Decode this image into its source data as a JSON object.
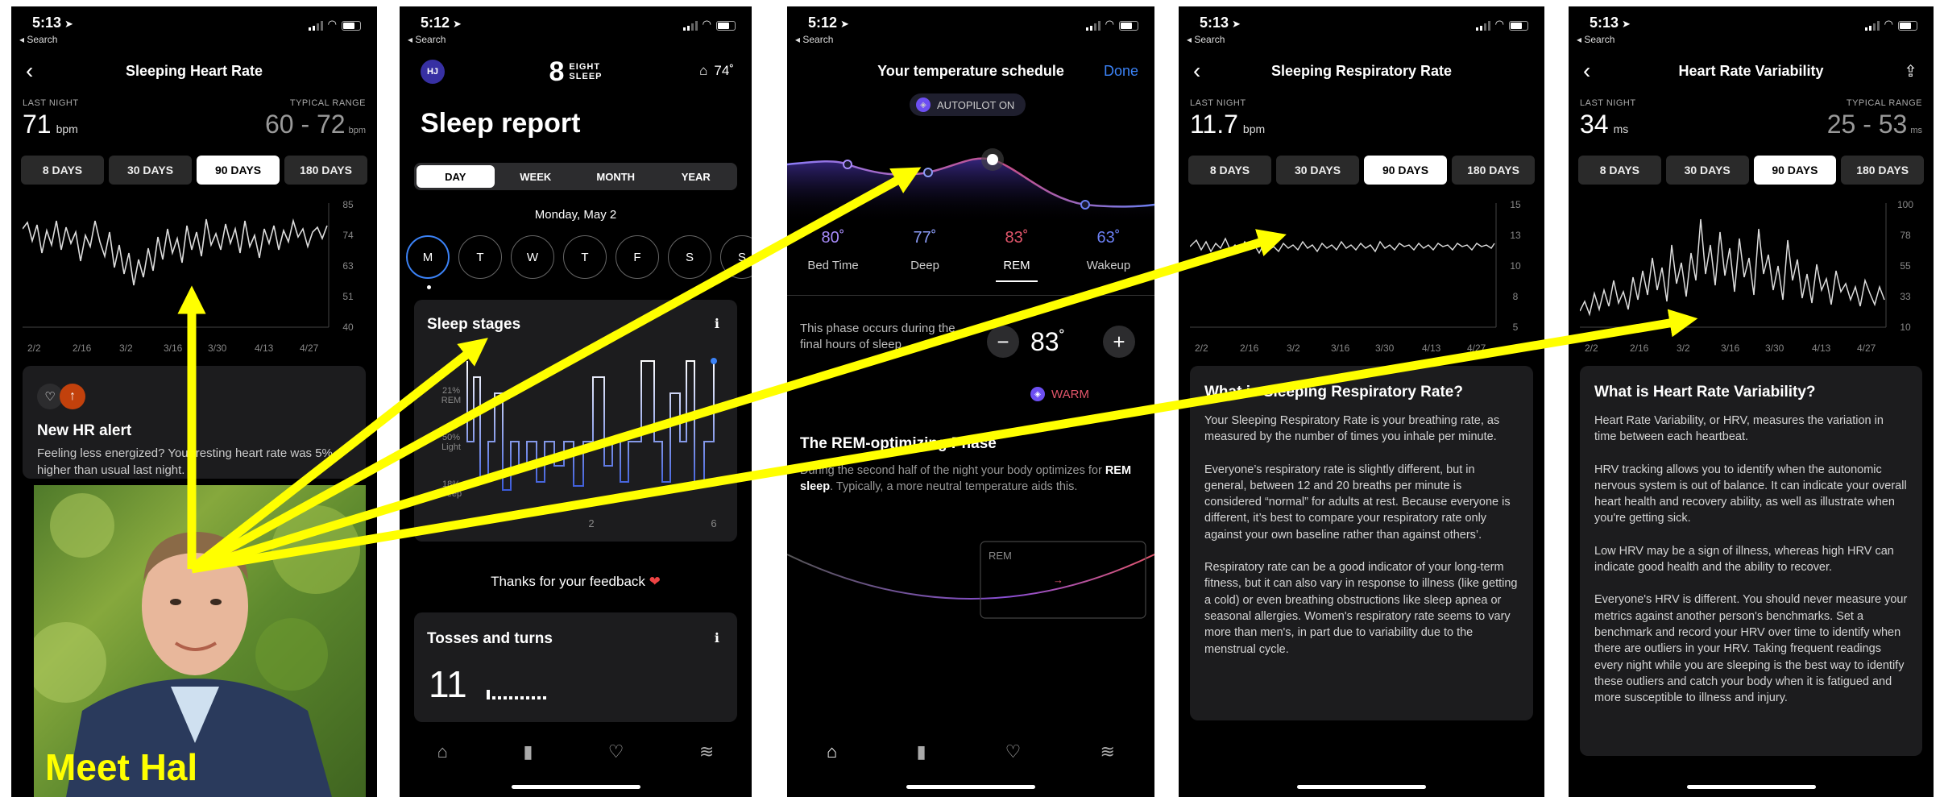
{
  "screens": {
    "hr": {
      "time": "5:13",
      "back_label": "◂ Search",
      "title": "Sleeping Heart Rate",
      "last_night_label": "LAST NIGHT",
      "value": "71",
      "unit": "bpm",
      "typical_label": "TYPICAL RANGE",
      "range": "60 - 72",
      "range_unit": "bpm",
      "tabs": [
        "8 DAYS",
        "30 DAYS",
        "90 DAYS",
        "180 DAYS"
      ],
      "active_tab": 2,
      "y_ticks": [
        "85",
        "74",
        "63",
        "51",
        "40"
      ],
      "x_ticks": [
        "2/2",
        "2/16",
        "3/2",
        "3/16",
        "3/30",
        "4/13",
        "4/27"
      ],
      "alert_title": "New HR alert",
      "alert_text": "Feeling less energized? Your resting heart rate was 5% higher than usual last night.",
      "photo_caption": "Meet Hal"
    },
    "report": {
      "time": "5:12",
      "back_label": "◂ Search",
      "avatar": "HJ",
      "logo_mark": "8",
      "logo_text_1": "EIGHT",
      "logo_text_2": "SLEEP",
      "temp": "74˚",
      "title": "Sleep report",
      "tabs": [
        "DAY",
        "WEEK",
        "MONTH",
        "YEAR"
      ],
      "active_tab": 0,
      "date": "Monday, May 2",
      "days": [
        "M",
        "T",
        "W",
        "T",
        "F",
        "S",
        "S"
      ],
      "stages_title": "Sleep stages",
      "stage_labels": [
        {
          "pct": "21%",
          "name": "REM"
        },
        {
          "pct": "50%",
          "name": "Light"
        },
        {
          "pct": "18%",
          "name": "Deep"
        }
      ],
      "stage_x_ticks": [
        "8",
        "2",
        "6"
      ],
      "feedback": "Thanks for your feedback",
      "tosses_title": "Tosses and turns",
      "tosses_value": "11"
    },
    "temp": {
      "time": "5:12",
      "back_label": "◂ Search",
      "title": "Your temperature schedule",
      "done": "Done",
      "autopilot": "AUTOPILOT ON",
      "phases": [
        {
          "temp": "80˚",
          "name": "Bed Time",
          "color": "#a78bfa"
        },
        {
          "temp": "77˚",
          "name": "Deep",
          "color": "#8b9cf7"
        },
        {
          "temp": "83˚",
          "name": "REM",
          "color": "#e0556a"
        },
        {
          "temp": "63˚",
          "name": "Wakeup",
          "color": "#6b7ff2"
        }
      ],
      "active_phase": 2,
      "phase_desc": "This phase occurs during the final hours of sleep.",
      "current_temp": "83",
      "deg": "˚",
      "warm": "WARM",
      "rem_title": "The REM-optimizing Phase",
      "rem_p_pre": "During the second half of the night your body optimizes for ",
      "rem_p_bold": "REM sleep",
      "rem_p_post": ". Typically, a more neutral temperature aids this.",
      "rem_box_label": "REM"
    },
    "resp": {
      "time": "5:13",
      "back_label": "◂ Search",
      "title": "Sleeping Respiratory Rate",
      "last_night_label": "LAST NIGHT",
      "value": "11.7",
      "unit": "bpm",
      "tabs": [
        "8 DAYS",
        "30 DAYS",
        "90 DAYS",
        "180 DAYS"
      ],
      "active_tab": 2,
      "y_ticks": [
        "15",
        "13",
        "10",
        "8",
        "5"
      ],
      "x_ticks": [
        "2/2",
        "2/16",
        "3/2",
        "3/16",
        "3/30",
        "4/13",
        "4/27"
      ],
      "info_title": "What is Sleeping Respiratory Rate?",
      "paras": [
        "Your Sleeping Respiratory Rate is your breathing rate, as measured by the number of times you inhale per minute.",
        "Everyone’s respiratory rate is slightly different, but in general, between 12 and 20 breaths per minute is considered “normal” for adults at rest. Because everyone is different, it’s best to compare your respiratory rate only against your own baseline rather than against others’.",
        "Respiratory rate can be a good indicator of your long-term fitness, but it can also vary in response to illness (like getting a cold) or even breathing obstructions like sleep apnea or seasonal allergies. Women's respiratory rate seems to vary more than men's, in part due to variability due to the menstrual cycle."
      ]
    },
    "hrv": {
      "time": "5:13",
      "back_label": "◂ Search",
      "title": "Heart Rate Variability",
      "last_night_label": "LAST NIGHT",
      "value": "34",
      "unit": "ms",
      "typical_label": "TYPICAL RANGE",
      "range": "25 - 53",
      "range_unit": "ms",
      "tabs": [
        "8 DAYS",
        "30 DAYS",
        "90 DAYS",
        "180 DAYS"
      ],
      "active_tab": 2,
      "y_ticks": [
        "100",
        "78",
        "55",
        "33",
        "10"
      ],
      "x_ticks": [
        "2/2",
        "2/16",
        "3/2",
        "3/16",
        "3/30",
        "4/13",
        "4/27"
      ],
      "info_title": "What is Heart Rate Variability?",
      "paras": [
        "Heart Rate Variability, or HRV, measures the variation in time between each heartbeat.",
        "HRV tracking allows you to identify when the autonomic nervous system is out of balance. It can indicate your overall heart health and recovery ability, as well as illustrate when you're getting sick.",
        "Low HRV may be a sign of illness, whereas high HRV can indicate good health and the ability to recover.",
        "Everyone's HRV is different. You should never measure your metrics against another person's benchmarks. Set a benchmark and record your HRV over time to identify when there are outliers in your HRV. Taking frequent readings every night while you are sleeping is the best way to identify these outliers and catch your body when it is fatigued and more susceptible to illness and injury."
      ]
    }
  },
  "colors": {
    "annotation_arrow": "#ffff00",
    "accent_blue": "#3b82f6",
    "warm": "#e0556a"
  }
}
